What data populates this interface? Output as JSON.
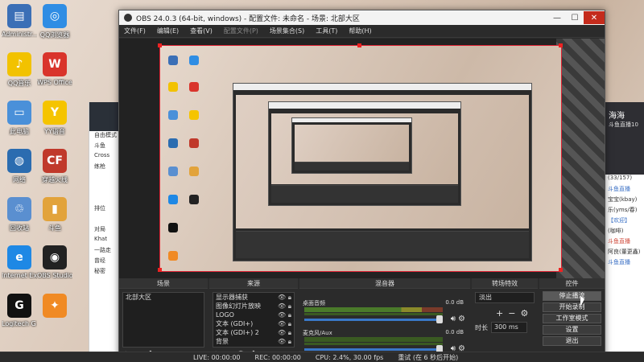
{
  "desktop": {
    "icons": [
      {
        "label": "Administr...",
        "glyph": "▤",
        "color": "#3b6fb6"
      },
      {
        "label": "QQ浏览器",
        "glyph": "◎",
        "color": "#2f8de4"
      },
      {
        "label": "QQ音乐",
        "glyph": "♪",
        "color": "#f2c200"
      },
      {
        "label": "WPS Office",
        "glyph": "W",
        "color": "#d9342b"
      },
      {
        "label": "此电脑",
        "glyph": "▭",
        "color": "#4a90d9"
      },
      {
        "label": "YY语音",
        "glyph": "Y",
        "color": "#f5c400"
      },
      {
        "label": "网络",
        "glyph": "◍",
        "color": "#2b6cb0"
      },
      {
        "label": "穿越火线",
        "glyph": "CF",
        "color": "#c0392b"
      },
      {
        "label": "回收站",
        "glyph": "♲",
        "color": "#5a8fd0"
      },
      {
        "label": "斗鱼",
        "glyph": "▮",
        "color": "#e2a33b"
      },
      {
        "label": "Internet Explorer",
        "glyph": "e",
        "color": "#1e88e5"
      },
      {
        "label": "OBS Studio",
        "glyph": "◉",
        "color": "#222222"
      },
      {
        "label": "Logitech G HUB",
        "glyph": "G",
        "color": "#111111"
      },
      {
        "label": "",
        "glyph": "✦",
        "color": "#f08a24"
      }
    ]
  },
  "left_app": {
    "lines": [
      "自由模式",
      "斗鱼",
      "Cross",
      "练枪",
      "",
      "",
      "",
      "排位",
      "",
      "对局",
      "Khat",
      "一路走",
      "曾经",
      "秘密"
    ]
  },
  "right_app": {
    "name": "海海",
    "sub": "斗鱼直播10",
    "lines": [
      {
        "text": "(33/157)",
        "style": "normal"
      },
      {
        "text": "斗鱼直播",
        "style": "blue"
      },
      {
        "text": "宝宝(kbay)",
        "style": "normal"
      },
      {
        "text": "乐(yms/春)",
        "style": "normal"
      },
      {
        "text": "【欢迎】",
        "style": "blue"
      },
      {
        "text": "(咖啡)",
        "style": "normal"
      },
      {
        "text": "斗鱼直播",
        "style": "red"
      },
      {
        "text": "阿良(董更鑫)",
        "style": "normal"
      },
      {
        "text": "斗鱼直播",
        "style": "blue"
      }
    ]
  },
  "obs": {
    "title": "OBS 24.0.3 (64-bit, windows) - 配置文件: 未命名 - 场景: 北部大区",
    "menu": [
      "文件(F)",
      "编辑(E)",
      "查看(V)",
      "配置文件(P)",
      "场景集合(S)",
      "工具(T)",
      "帮助(H)"
    ],
    "menu_disabled": [
      false,
      false,
      false,
      true,
      false,
      false,
      false
    ],
    "docks": {
      "scenes": {
        "title": "场景",
        "items": [
          "北部大区"
        ]
      },
      "sources": {
        "title": "来源",
        "items": [
          "显示器捕获",
          "图像幻灯片放映",
          "LOGO",
          "文本 (GDI+)",
          "文本 (GDI+) 2",
          "背景"
        ]
      },
      "mixer": {
        "title": "混音器",
        "channels": [
          {
            "name": "桌面音频",
            "db": "0.0 dB"
          },
          {
            "name": "麦克风/Aux",
            "db": "0.0 dB"
          }
        ]
      },
      "transitions": {
        "title": "转场特效",
        "selected": "淡出",
        "duration_label": "时长",
        "duration_value": "300 ms"
      },
      "controls": {
        "title": "控件",
        "buttons": [
          "停止播流",
          "开始录制",
          "工作室模式",
          "设置",
          "退出"
        ]
      }
    },
    "status": {
      "live": "LIVE: 00:00:00",
      "rec": "REC: 00:00:00",
      "cpu": "CPU: 2.4%, 30.00 fps",
      "retry": "重试 (在 6 秒后开始)"
    }
  }
}
